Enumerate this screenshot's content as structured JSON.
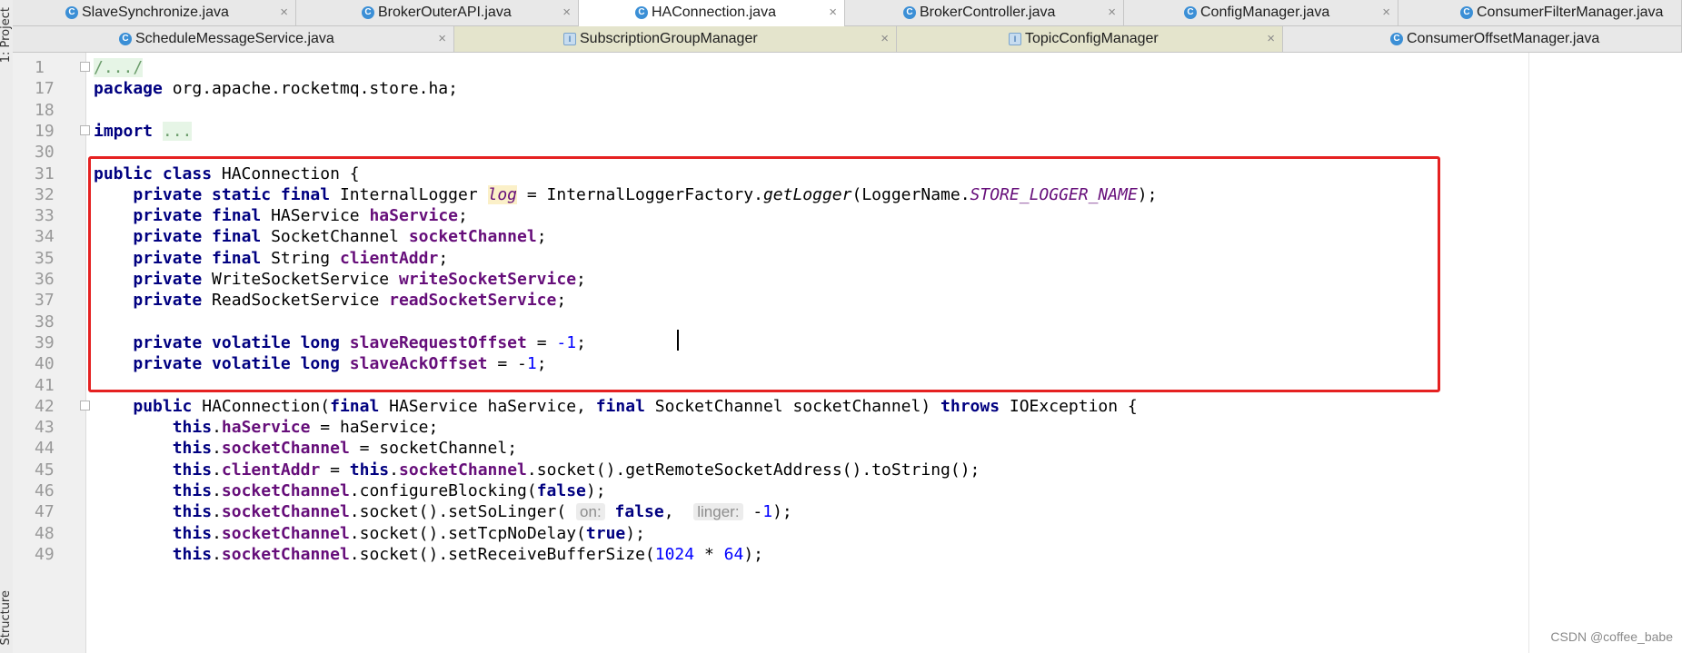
{
  "side_panel": {
    "project_label": "1: Project",
    "structure_label": "Structure"
  },
  "tabs_row1": [
    {
      "label": "SlaveSynchronize.java",
      "close": "×",
      "icon": "c"
    },
    {
      "label": "BrokerOuterAPI.java",
      "close": "×",
      "icon": "c"
    },
    {
      "label": "HAConnection.java",
      "close": "×",
      "icon": "c"
    },
    {
      "label": "BrokerController.java",
      "close": "×",
      "icon": "c"
    },
    {
      "label": "ConfigManager.java",
      "close": "×",
      "icon": "c"
    },
    {
      "label": "ConsumerFilterManager.java",
      "close": "",
      "icon": "c"
    }
  ],
  "tabs_row2": [
    {
      "label": "ScheduleMessageService.java",
      "close": "×",
      "icon": "c"
    },
    {
      "label": "SubscriptionGroupManager",
      "close": "×",
      "icon": "intf"
    },
    {
      "label": "TopicConfigManager",
      "close": "×",
      "icon": "intf"
    },
    {
      "label": "ConsumerOffsetManager.java",
      "close": "",
      "icon": "c"
    }
  ],
  "lines": [
    {
      "n": "1",
      "t": [
        "/.../"
      ]
    },
    {
      "n": "17",
      "t": [
        "package",
        " org.apache.rocketmq.store.ha;"
      ]
    },
    {
      "n": "18",
      "t": []
    },
    {
      "n": "19",
      "t": [
        "import",
        " ",
        "..."
      ]
    },
    {
      "n": "30",
      "t": []
    },
    {
      "n": "31",
      "t": [
        "public class",
        " HAConnection {"
      ]
    },
    {
      "n": "32",
      "t": [
        "    ",
        "private static final",
        " InternalLogger ",
        "log",
        " = InternalLoggerFactory.",
        "getLogger",
        "(LoggerName.",
        "STORE_LOGGER_NAME",
        ");"
      ]
    },
    {
      "n": "33",
      "t": [
        "    ",
        "private final",
        " HAService ",
        "haService",
        ";"
      ]
    },
    {
      "n": "34",
      "t": [
        "    ",
        "private final",
        " SocketChannel ",
        "socketChannel",
        ";"
      ]
    },
    {
      "n": "35",
      "t": [
        "    ",
        "private final",
        " String ",
        "clientAddr",
        ";"
      ]
    },
    {
      "n": "36",
      "t": [
        "    ",
        "private",
        " WriteSocketService ",
        "writeSocketService",
        ";"
      ]
    },
    {
      "n": "37",
      "t": [
        "    ",
        "private",
        " ReadSocketService ",
        "readSocketService",
        ";"
      ]
    },
    {
      "n": "38",
      "t": []
    },
    {
      "n": "39",
      "t": [
        "    ",
        "private volatile long",
        " ",
        "slaveRequestOffset",
        " = ",
        "-1",
        ";"
      ]
    },
    {
      "n": "40",
      "t": [
        "    ",
        "private volatile long",
        " ",
        "slaveAckOffset",
        " = -",
        "1",
        ";"
      ]
    },
    {
      "n": "41",
      "t": []
    },
    {
      "n": "42",
      "t": [
        "    ",
        "public",
        " HAConnection(",
        "final",
        " HAService haService, ",
        "final",
        " SocketChannel socketChannel) ",
        "throws",
        " IOException {"
      ]
    },
    {
      "n": "43",
      "t": [
        "        ",
        "this",
        ".",
        "haService",
        " = haService;"
      ]
    },
    {
      "n": "44",
      "t": [
        "        ",
        "this",
        ".",
        "socketChannel",
        " = socketChannel;"
      ]
    },
    {
      "n": "45",
      "t": [
        "        ",
        "this",
        ".",
        "clientAddr",
        " = ",
        "this",
        ".",
        "socketChannel",
        ".socket().getRemoteSocketAddress().toString();"
      ]
    },
    {
      "n": "46",
      "t": [
        "        ",
        "this",
        ".",
        "socketChannel",
        ".configureBlocking(",
        "false",
        ");"
      ]
    },
    {
      "n": "47",
      "t": [
        "        ",
        "this",
        ".",
        "socketChannel",
        ".socket().setSoLinger( ",
        "on:",
        " ",
        "false",
        ",  ",
        "linger:",
        " -",
        "1",
        ");"
      ]
    },
    {
      "n": "48",
      "t": [
        "        ",
        "this",
        ".",
        "socketChannel",
        ".socket().setTcpNoDelay(",
        "true",
        ");"
      ]
    },
    {
      "n": "49",
      "t": [
        "        ",
        "this",
        ".",
        "socketChannel",
        ".socket().setReceiveBufferSize(",
        "1024",
        " * ",
        "64",
        ");"
      ]
    }
  ],
  "watermark": "CSDN @coffee_babe",
  "colors": {
    "keyword": "#000080",
    "field": "#660e7a",
    "number": "#0000ff",
    "highlight_box": "#e52121",
    "current_line": "#fffae3"
  }
}
